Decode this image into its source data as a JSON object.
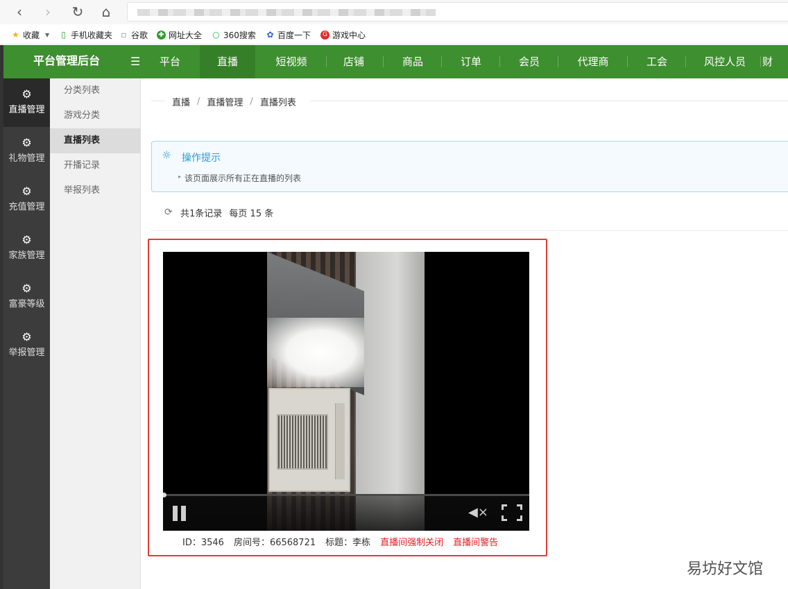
{
  "bookmarks": [
    {
      "label": "收藏",
      "icon": "star-icon"
    },
    {
      "label": "手机收藏夹",
      "icon": "phone-icon"
    },
    {
      "label": "谷歌",
      "icon": "page-icon"
    },
    {
      "label": "网址大全",
      "icon": "site-nav-icon"
    },
    {
      "label": "360搜索",
      "icon": "search-360-icon"
    },
    {
      "label": "百度一下",
      "icon": "baidu-paw-icon"
    },
    {
      "label": "游戏中心",
      "icon": "game-center-icon"
    }
  ],
  "header": {
    "title": "平台管理后台",
    "nav": [
      "平台",
      "直播",
      "短视频",
      "店铺",
      "商品",
      "订单",
      "会员",
      "代理商",
      "工会",
      "风控人员",
      "财"
    ],
    "active_nav": "直播"
  },
  "sidebar": {
    "items": [
      "直播管理",
      "礼物管理",
      "充值管理",
      "家族管理",
      "富豪等级",
      "举报管理"
    ],
    "active": "直播管理"
  },
  "submenu": {
    "items": [
      "分类列表",
      "游戏分类",
      "直播列表",
      "开播记录",
      "举报列表"
    ],
    "active": "直播列表"
  },
  "breadcrumb": [
    "直播",
    "直播管理",
    "直播列表"
  ],
  "tips": {
    "title": "操作提示",
    "text": "该页面展示所有正在直播的列表"
  },
  "records": {
    "total": "共1条记录",
    "per_page": "每页 15 条"
  },
  "live_card": {
    "id": "ID：3546",
    "room": "房间号：66568721",
    "title": "标题：李栋",
    "force_close": "直播间强制关闭",
    "warn": "直播间警告",
    "progress": 0
  },
  "watermark": "易坊好文馆",
  "colors": {
    "header_green": "#3e8f2f",
    "sidebar_dark": "#3c3c3c",
    "tip_blue": "#2d9ad6",
    "danger_red": "#e02020"
  }
}
